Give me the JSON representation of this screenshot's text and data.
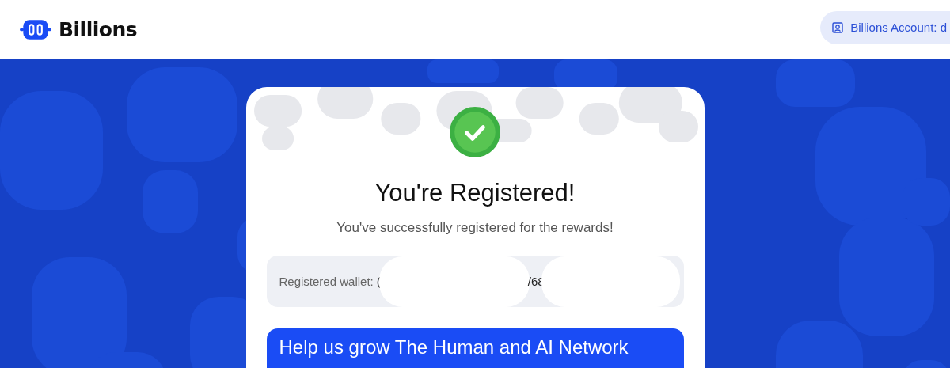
{
  "header": {
    "brand": "Billions",
    "account": {
      "label": "Billions Account: d"
    }
  },
  "card": {
    "title": "You're Registered!",
    "subtitle": "You've successfully registered for the rewards!",
    "wallet": {
      "label": "Registered wallet:",
      "value_fragments": [
        "(",
        "/68"
      ],
      "redacted": true
    },
    "cta": {
      "label": "Help us grow The Human and AI Network"
    }
  }
}
